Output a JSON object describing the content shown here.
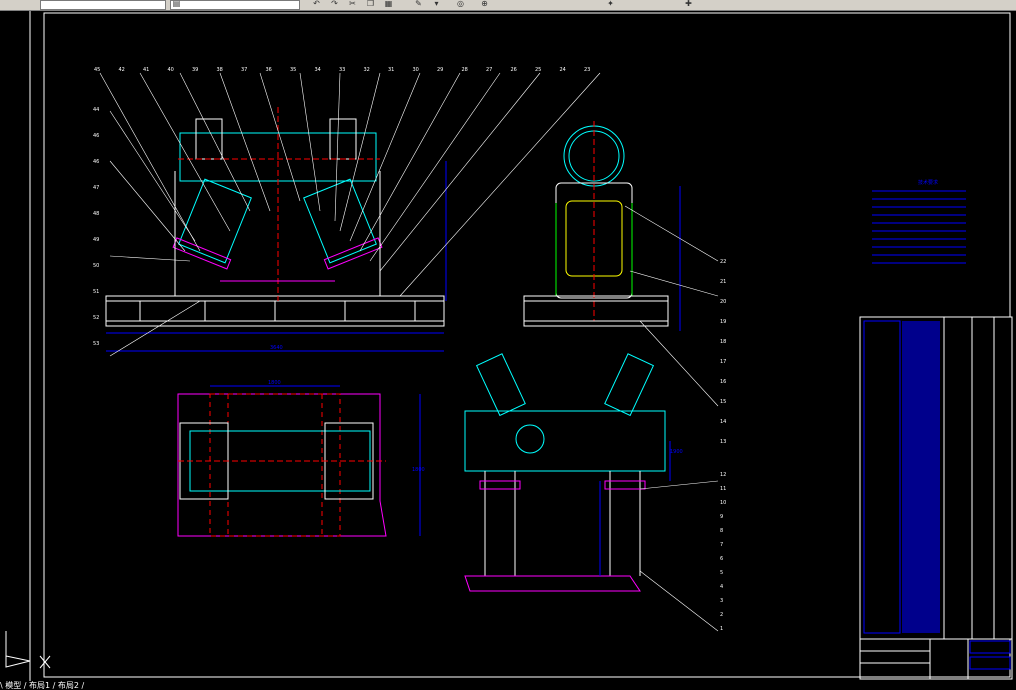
{
  "toolbar": {
    "layer_field": "",
    "icons": [
      "layer-manager-icon",
      "undo-icon",
      "redo-icon",
      "cut-icon",
      "copy-icon",
      "paste-icon",
      "match-props-icon",
      "zoom-icon",
      "pan-icon",
      "zoom-realtime-icon",
      "properties-icon",
      "help-icon"
    ]
  },
  "status": {
    "text": "\\ 模型 ∕ 布局1 ∕ 布局2 ∕"
  },
  "drawing": {
    "dim_overall_width": "3640",
    "dim_side_width": "1900",
    "dim_plan_width": "1800",
    "dim_plan_height": "1800",
    "notes_title": "技术要求",
    "balloons_left_top": [
      "45",
      "42",
      "41",
      "40",
      "39",
      "38",
      "37",
      "36",
      "35",
      "34",
      "33",
      "32",
      "31",
      "30",
      "29",
      "28",
      "27",
      "26",
      "25",
      "24",
      "23"
    ],
    "balloons_left_side": [
      "44",
      "46",
      "46",
      "47",
      "48",
      "49",
      "50",
      "51",
      "52",
      "53"
    ],
    "balloons_right": [
      "22",
      "21",
      "20",
      "19",
      "18",
      "17",
      "16",
      "15",
      "14",
      "13"
    ],
    "balloons_bottom_right": [
      "12",
      "11",
      "10",
      "9",
      "8",
      "7",
      "6",
      "5",
      "4",
      "3",
      "2",
      "1"
    ]
  },
  "colors": {
    "background": "#000000",
    "outline": "#ffffff",
    "cyan": "#00ffff",
    "blue": "#0000ff",
    "magenta": "#ff00ff",
    "red": "#ff0000",
    "green": "#00ff00",
    "yellow": "#ffff00"
  }
}
